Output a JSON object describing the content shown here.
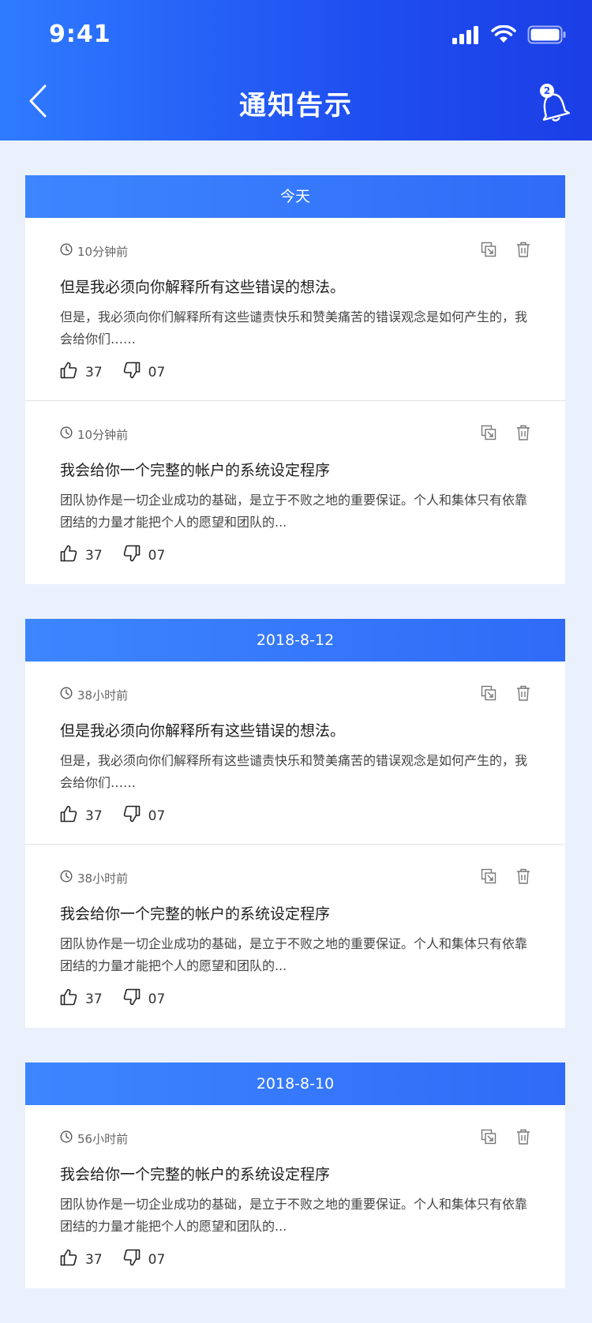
{
  "status_bar": {
    "time": "9:41"
  },
  "header": {
    "title": "通知告示",
    "badge_count": "2"
  },
  "groups": [
    {
      "label": "今天",
      "items": [
        {
          "time": "10分钟前",
          "title": "但是我必须向你解释所有这些错误的想法。",
          "summary": "但是，我必须向你们解释所有这些谴责快乐和赞美痛苦的错误观念是如何产生的，我会给你们……",
          "likes": "37",
          "dislikes": "07"
        },
        {
          "time": "10分钟前",
          "title": "我会给你一个完整的帐户的系统设定程序",
          "summary": "团队协作是一切企业成功的基础，是立于不败之地的重要保证。个人和集体只有依靠团结的力量才能把个人的愿望和团队的...",
          "likes": "37",
          "dislikes": "07"
        }
      ]
    },
    {
      "label": "2018-8-12",
      "items": [
        {
          "time": "38小时前",
          "title": "但是我必须向你解释所有这些错误的想法。",
          "summary": "但是，我必须向你们解释所有这些谴责快乐和赞美痛苦的错误观念是如何产生的，我会给你们……",
          "likes": "37",
          "dislikes": "07"
        },
        {
          "time": "38小时前",
          "title": "我会给你一个完整的帐户的系统设定程序",
          "summary": "团队协作是一切企业成功的基础，是立于不败之地的重要保证。个人和集体只有依靠团结的力量才能把个人的愿望和团队的...",
          "likes": "37",
          "dislikes": "07"
        }
      ]
    },
    {
      "label": "2018-8-10",
      "items": [
        {
          "time": "56小时前",
          "title": "我会给你一个完整的帐户的系统设定程序",
          "summary": "团队协作是一切企业成功的基础，是立于不败之地的重要保证。个人和集体只有依靠团结的力量才能把个人的愿望和团队的...",
          "likes": "37",
          "dislikes": "07"
        }
      ]
    }
  ],
  "icons": {
    "back": "chevron-left-icon",
    "bell": "bell-icon",
    "clock": "clock-icon",
    "copy": "copy-icon",
    "delete": "trash-icon",
    "like": "thumbs-up-icon",
    "dislike": "thumbs-down-icon"
  },
  "colors": {
    "header_start": "#2f7bff",
    "header_end": "#1b3ee6",
    "group_header": "#3d86ff",
    "page_bg": "#eaf1fc"
  }
}
